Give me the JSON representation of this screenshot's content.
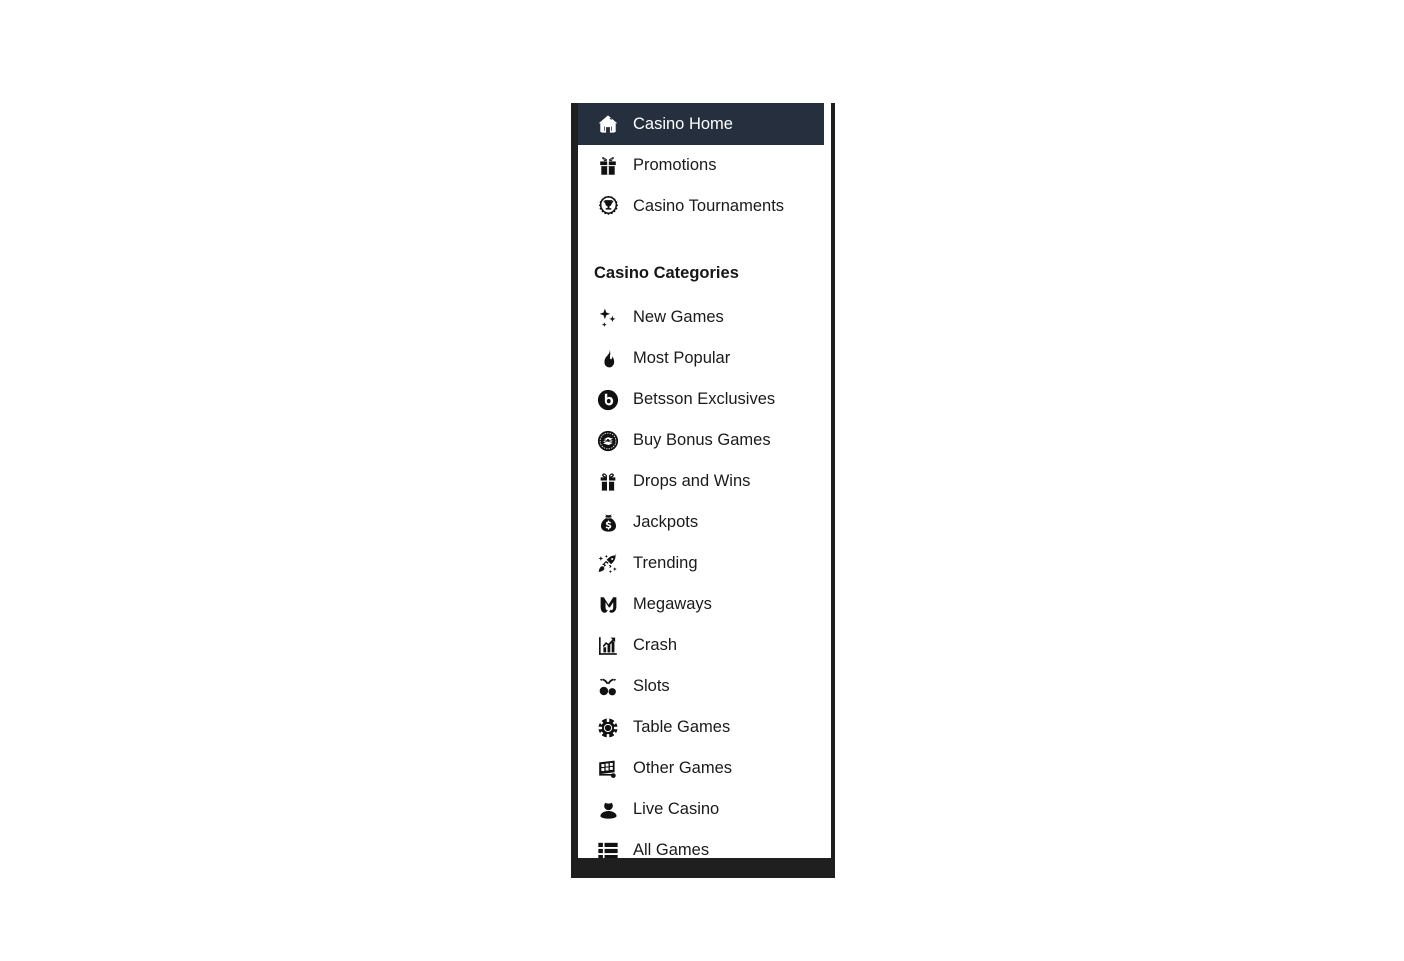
{
  "theme": {
    "accent_color": "#f26722",
    "active_bg": "#252f3e",
    "frame_color": "#1f1f1f",
    "panel_bg": "#ffffff",
    "text_color": "#1a1a1a",
    "active_text_color": "#ffffff"
  },
  "menu": {
    "top_items": [
      {
        "label": "Casino Home",
        "icon": "home-icon",
        "active": true
      },
      {
        "label": "Promotions",
        "icon": "gift-box-icon",
        "active": false
      },
      {
        "label": "Casino Tournaments",
        "icon": "trophy-wreath-icon",
        "active": false
      }
    ],
    "section_heading": "Casino Categories",
    "category_items": [
      {
        "label": "New Games",
        "icon": "sparkles-icon"
      },
      {
        "label": "Most Popular",
        "icon": "flame-icon"
      },
      {
        "label": "Betsson Exclusives",
        "icon": "betsson-b-circle-icon"
      },
      {
        "label": "Buy Bonus Games",
        "icon": "money-circle-icon"
      },
      {
        "label": "Drops and Wins",
        "icon": "gift-icon"
      },
      {
        "label": "Jackpots",
        "icon": "money-bag-icon"
      },
      {
        "label": "Trending",
        "icon": "rocket-icon"
      },
      {
        "label": "Megaways",
        "icon": "megaways-m-icon"
      },
      {
        "label": "Crash",
        "icon": "growth-chart-icon"
      },
      {
        "label": "Slots",
        "icon": "cherries-icon"
      },
      {
        "label": "Table Games",
        "icon": "poker-chip-icon"
      },
      {
        "label": "Other Games",
        "icon": "bingo-card-icon"
      },
      {
        "label": "Live Casino",
        "icon": "dealer-person-icon"
      },
      {
        "label": "All Games",
        "icon": "list-view-icon"
      }
    ]
  }
}
